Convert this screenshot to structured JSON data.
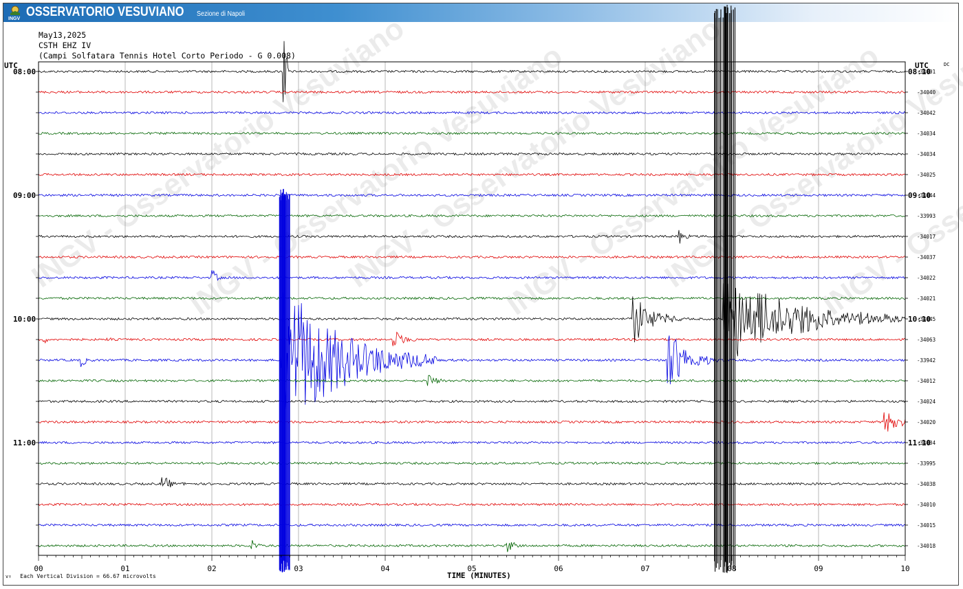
{
  "header": {
    "logo_text": "INGV",
    "title": "OSSERVATORIO VESUVIANO",
    "subtitle": "Sezione di Napoli"
  },
  "station": {
    "date": "May13,2025",
    "channel": "CSTH EHZ IV",
    "description": "(Campi Solfatara Tennis Hotel Corto Periodo - G 0.008)"
  },
  "watermark": "INGV - Osservatorio Vesuviano",
  "chart_data": {
    "type": "line",
    "subtype": "helicorder",
    "left_axis_label": "UTC",
    "right_axis_label": "UTC",
    "dc_label": "DC",
    "xlabel": "TIME (MINUTES)",
    "x_ticks": [
      "00",
      "01",
      "02",
      "03",
      "04",
      "05",
      "06",
      "07",
      "08",
      "09",
      "10"
    ],
    "xlim": [
      0,
      10
    ],
    "grid": true,
    "trace_colors": [
      "#000000",
      "#e00000",
      "#0000e0",
      "#006400"
    ],
    "left_time_labels": [
      {
        "row": 0,
        "label": "08:00"
      },
      {
        "row": 6,
        "label": "09:00"
      },
      {
        "row": 12,
        "label": "10:00"
      },
      {
        "row": 18,
        "label": "11:00"
      }
    ],
    "right_time_labels": [
      {
        "row": 0,
        "label": "08:10"
      },
      {
        "row": 6,
        "label": "09:10"
      },
      {
        "row": 12,
        "label": "10:10"
      },
      {
        "row": 18,
        "label": "11:10"
      }
    ],
    "dc_values": [
      "-34001",
      "-34040",
      "-34042",
      "-34034",
      "-34034",
      "-34025",
      "-34044",
      "-33993",
      "-34017",
      "-34037",
      "-34022",
      "-34021",
      "-34045",
      "-34063",
      "-33942",
      "-34012",
      "-34024",
      "-34020",
      "-34034",
      "-33995",
      "-34038",
      "-34010",
      "-34015",
      "-34018"
    ],
    "events": [
      {
        "row": 0,
        "minute": 2.82,
        "amp": 120,
        "dur": 0.08,
        "color_row": 0
      },
      {
        "row": 10,
        "minute": 2.0,
        "amp": 14,
        "dur": 0.15
      },
      {
        "row": 12,
        "minute": 6.85,
        "amp": 40,
        "dur": 0.6
      },
      {
        "row": 12,
        "minute": 7.9,
        "amp": 70,
        "dur": 2.2
      },
      {
        "row": 13,
        "minute": 0.05,
        "amp": 8,
        "dur": 0.1
      },
      {
        "row": 13,
        "minute": 0.78,
        "amp": 6,
        "dur": 0.1
      },
      {
        "row": 13,
        "minute": 4.08,
        "amp": 18,
        "dur": 0.35
      },
      {
        "row": 14,
        "minute": 0.48,
        "amp": 14,
        "dur": 0.15
      },
      {
        "row": 14,
        "minute": 2.8,
        "amp": 120,
        "dur": 1.8
      },
      {
        "row": 14,
        "minute": 7.25,
        "amp": 50,
        "dur": 0.6
      },
      {
        "row": 15,
        "minute": 4.48,
        "amp": 16,
        "dur": 0.2
      },
      {
        "row": 17,
        "minute": 9.75,
        "amp": 30,
        "dur": 0.35
      },
      {
        "row": 8,
        "minute": 7.38,
        "amp": 14,
        "dur": 0.15
      },
      {
        "row": 20,
        "minute": 1.42,
        "amp": 12,
        "dur": 0.3
      },
      {
        "row": 23,
        "minute": 2.45,
        "amp": 12,
        "dur": 0.15
      },
      {
        "row": 23,
        "minute": 5.4,
        "amp": 14,
        "dur": 0.2
      }
    ],
    "saturated_bands": [
      {
        "minute_start": 2.78,
        "minute_end": 2.9,
        "row_start": 9,
        "row_end": 23,
        "color": "#0000e0"
      },
      {
        "minute_start": 7.8,
        "minute_end": 8.05,
        "row_start": 0,
        "row_end": 23,
        "color": "#000000"
      }
    ]
  },
  "footer": {
    "symbol": "v↑",
    "note": "Each Vertical Division =   66.67 microvolts"
  }
}
